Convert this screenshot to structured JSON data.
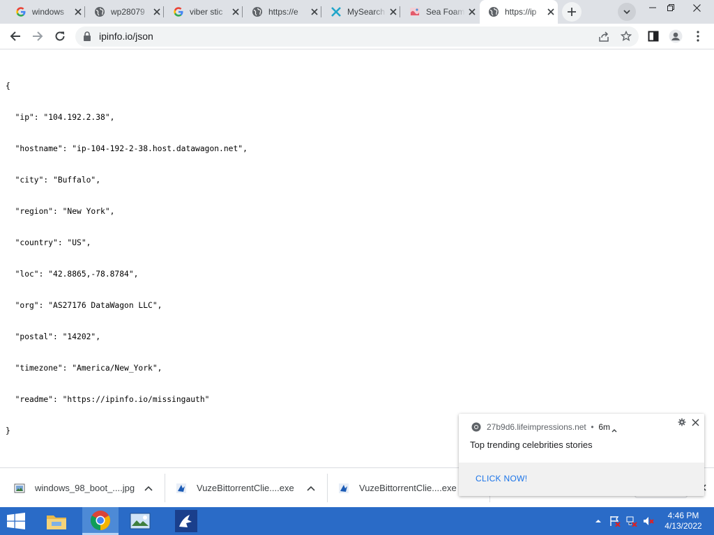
{
  "browser": {
    "tabs": [
      {
        "title": "windows",
        "favicon": "google-icon"
      },
      {
        "title": "wp28079",
        "favicon": "globe-icon"
      },
      {
        "title": "viber stic",
        "favicon": "google-icon"
      },
      {
        "title": "https://e",
        "favicon": "globe-icon"
      },
      {
        "title": "MySearch",
        "favicon": "mysearch-icon"
      },
      {
        "title": "Sea Foam",
        "favicon": "seafoam-icon"
      },
      {
        "title": "https://ip",
        "favicon": "globe-icon",
        "active": true
      }
    ],
    "url": "ipinfo.io/json"
  },
  "content": {
    "json_lines": [
      "{",
      "  \"ip\": \"104.192.2.38\",",
      "  \"hostname\": \"ip-104-192-2-38.host.datawagon.net\",",
      "  \"city\": \"Buffalo\",",
      "  \"region\": \"New York\",",
      "  \"country\": \"US\",",
      "  \"loc\": \"42.8865,-78.8784\",",
      "  \"org\": \"AS27176 DataWagon LLC\",",
      "  \"postal\": \"14202\",",
      "  \"timezone\": \"America/New_York\",",
      "  \"readme\": \"https://ipinfo.io/missingauth\"",
      "}"
    ]
  },
  "downloads": {
    "items": [
      {
        "name": "windows_98_boot_....jpg"
      },
      {
        "name": "VuzeBittorrentClie....exe"
      },
      {
        "name": "VuzeBittorrentClie....exe"
      }
    ]
  },
  "notification": {
    "origin": "27b9d6.lifeimpressions.net",
    "age": "6m",
    "message": "Top trending celebrities stories",
    "action": "CLICK NOW!"
  },
  "taskbar": {
    "time": "4:46 PM",
    "date": "4/13/2022"
  },
  "colors": {
    "accent": "#1a73e8",
    "taskbar": "#2a6bc7",
    "tabstrip": "#dee1e6"
  }
}
